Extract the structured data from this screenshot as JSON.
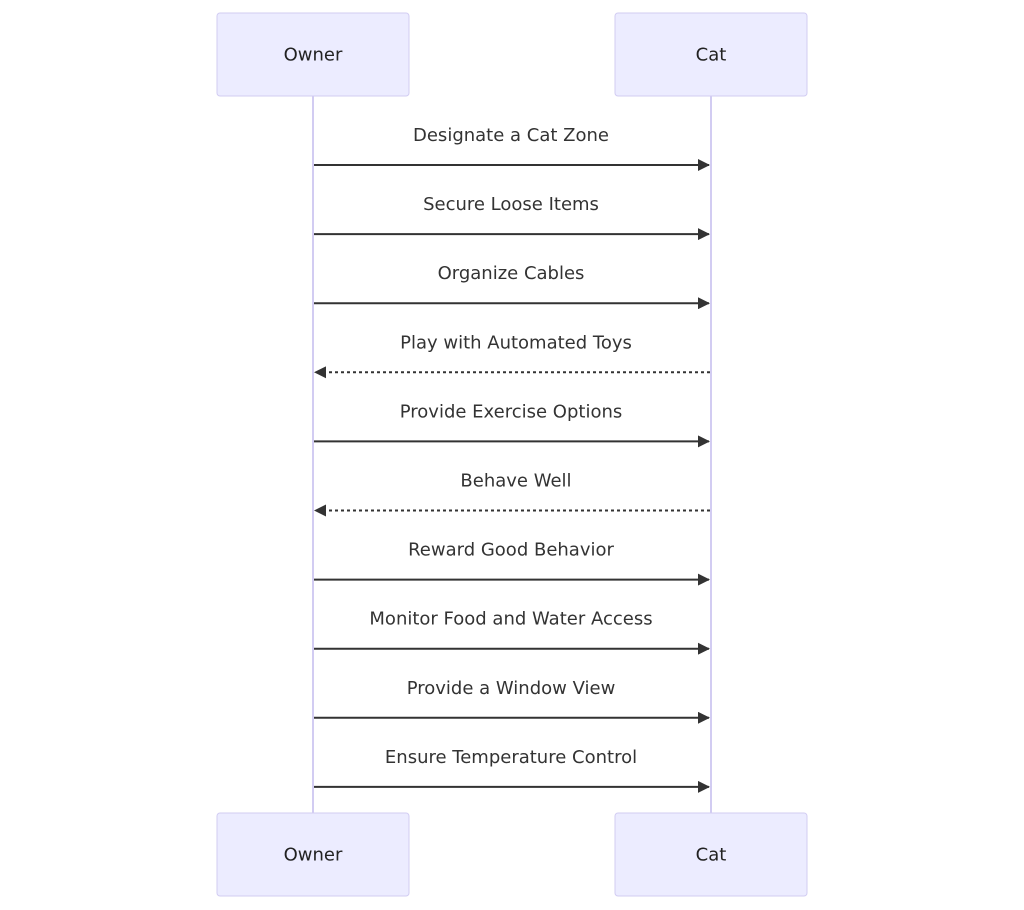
{
  "diagram": {
    "type": "sequence",
    "actors": [
      {
        "id": "owner",
        "label": "Owner"
      },
      {
        "id": "cat",
        "label": "Cat"
      }
    ],
    "messages": [
      {
        "from": "owner",
        "to": "cat",
        "label": "Designate a Cat Zone",
        "style": "solid"
      },
      {
        "from": "owner",
        "to": "cat",
        "label": "Secure Loose Items",
        "style": "solid"
      },
      {
        "from": "owner",
        "to": "cat",
        "label": "Organize Cables",
        "style": "solid"
      },
      {
        "from": "cat",
        "to": "owner",
        "label": "Play with Automated Toys",
        "style": "dotted"
      },
      {
        "from": "owner",
        "to": "cat",
        "label": "Provide Exercise Options",
        "style": "solid"
      },
      {
        "from": "cat",
        "to": "owner",
        "label": "Behave Well",
        "style": "dotted"
      },
      {
        "from": "owner",
        "to": "cat",
        "label": "Reward Good Behavior",
        "style": "solid"
      },
      {
        "from": "owner",
        "to": "cat",
        "label": "Monitor Food and Water Access",
        "style": "solid"
      },
      {
        "from": "owner",
        "to": "cat",
        "label": "Provide a Window View",
        "style": "solid"
      },
      {
        "from": "owner",
        "to": "cat",
        "label": "Ensure Temperature Control",
        "style": "solid"
      }
    ]
  }
}
